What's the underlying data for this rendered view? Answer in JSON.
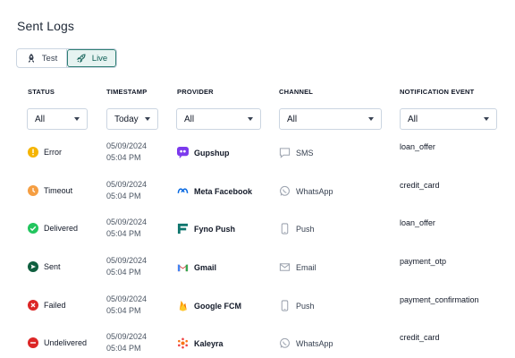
{
  "page": {
    "title": "Sent Logs"
  },
  "env_toggle": {
    "test_label": "Test",
    "live_label": "Live",
    "selected": "Live"
  },
  "columns": {
    "status": "STATUS",
    "timestamp": "TIMESTAMP",
    "provider": "PROVIDER",
    "channel": "CHANNEL",
    "event": "NOTIFICATION EVENT"
  },
  "filters": {
    "status": "All",
    "timestamp": "Today",
    "provider": "All",
    "channel": "All",
    "event": "All"
  },
  "rows": [
    {
      "status": "Error",
      "status_icon": "error-icon",
      "status_color": "#f5b400",
      "date": "05/09/2024",
      "time": "05:04 PM",
      "provider": "Gupshup",
      "provider_icon": "gupshup-logo-icon",
      "channel": "SMS",
      "channel_icon": "sms-icon",
      "event": "loan_offer"
    },
    {
      "status": "Timeout",
      "status_icon": "timeout-icon",
      "status_color": "#f59e42",
      "date": "05/09/2024",
      "time": "05:04 PM",
      "provider": "Meta Facebook",
      "provider_icon": "meta-logo-icon",
      "channel": "WhatsApp",
      "channel_icon": "whatsapp-icon",
      "event": "credit_card"
    },
    {
      "status": "Delivered",
      "status_icon": "delivered-icon",
      "status_color": "#22c55e",
      "date": "05/09/2024",
      "time": "05:04 PM",
      "provider": "Fyno Push",
      "provider_icon": "fyno-logo-icon",
      "channel": "Push",
      "channel_icon": "push-icon",
      "event": "loan_offer"
    },
    {
      "status": "Sent",
      "status_icon": "sent-icon",
      "status_color": "#0f5f3f",
      "date": "05/09/2024",
      "time": "05:04 PM",
      "provider": "Gmail",
      "provider_icon": "gmail-logo-icon",
      "channel": "Email",
      "channel_icon": "email-icon",
      "event": "payment_otp"
    },
    {
      "status": "Failed",
      "status_icon": "failed-icon",
      "status_color": "#dc2626",
      "date": "05/09/2024",
      "time": "05:04 PM",
      "provider": "Google FCM",
      "provider_icon": "fcm-logo-icon",
      "channel": "Push",
      "channel_icon": "push-icon",
      "event": "payment_confirmation"
    },
    {
      "status": "Undelivered",
      "status_icon": "undelivered-icon",
      "status_color": "#dc2626",
      "date": "05/09/2024",
      "time": "05:04 PM",
      "provider": "Kaleyra",
      "provider_icon": "kaleyra-logo-icon",
      "channel": "WhatsApp",
      "channel_icon": "whatsapp-icon",
      "event": "credit_card"
    }
  ]
}
